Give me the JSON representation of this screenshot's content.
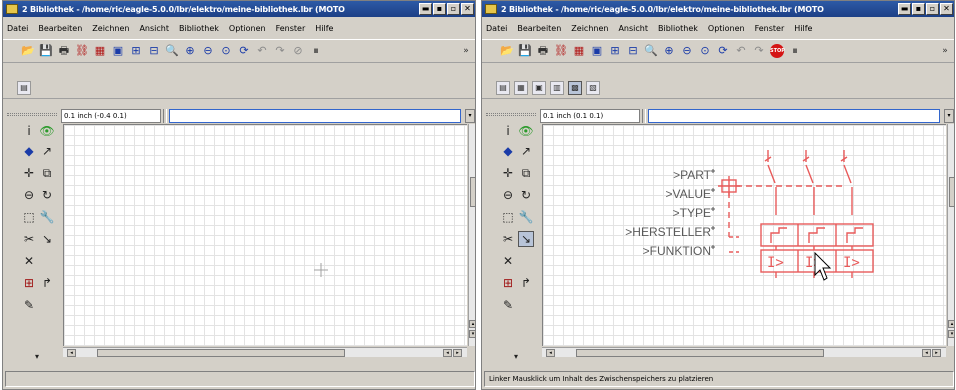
{
  "left": {
    "title": "2 Bibliothek - /home/ric/eagle-5.0.0/lbr/elektro/meine-bibliothek.lbr (MOTO",
    "coord": "0.1 inch (-0.4 0.1)",
    "status": ""
  },
  "right": {
    "title": "2 Bibliothek - /home/ric/eagle-5.0.0/lbr/elektro/meine-bibliothek.lbr (MOTO",
    "coord": "0.1 inch (0.1 0.1)",
    "status": "Linker Mausklick um Inhalt des Zwischenspeichers zu platzieren"
  },
  "menu": [
    "Datei",
    "Bearbeiten",
    "Zeichnen",
    "Ansicht",
    "Bibliothek",
    "Optionen",
    "Fenster",
    "Hilfe"
  ],
  "title_buttons": [
    "▬",
    "▪",
    "▫",
    "✕"
  ],
  "toolbar_glyphs": {
    "open": "📂",
    "save": "💾",
    "print": "🖶",
    "cam": "⛓",
    "sch": "▦",
    "brd": "▣",
    "lib1": "⊞",
    "lib2": "⊟",
    "zoom_fit": "🔍",
    "zoom_in": "⊕",
    "zoom_out": "⊖",
    "zoom_sel": "⊙",
    "redraw": "⟳",
    "undo": "↶",
    "redo": "↷",
    "stop": "STOP",
    "stop_gray": "⊘",
    "pause": "⏸",
    "more": "»"
  },
  "toolbar2_glyphs": [
    "▤",
    "▦",
    "▣",
    "▥",
    "▩",
    "▧"
  ],
  "side_glyphs": {
    "info": "i",
    "show": "👁",
    "display": "◆",
    "mark": "↗",
    "move": "✛",
    "copy": "⧉",
    "mirror": "⊖",
    "rotate": "↻",
    "group": "⬚",
    "change": "🔧",
    "cut": "✂",
    "paste": "↘",
    "delete": "✕",
    "add": "⊞",
    "wire": "↱",
    "edit": "✎",
    "scroll_more": "▾"
  },
  "scroll_arrows": {
    "up": "▴",
    "down": "▾",
    "left": "◂",
    "right": "▸"
  },
  "schematic": {
    "labels": [
      ">PART",
      ">VALUE",
      ">TYPE",
      ">HERSTELLER",
      ">FUNKTION"
    ],
    "trip": "I>",
    "color": "#e85a5a"
  }
}
